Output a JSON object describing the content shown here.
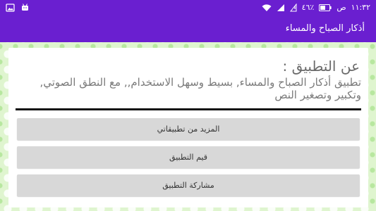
{
  "status_bar": {
    "time": "١١:٣٢",
    "ampm": "ص",
    "battery_percent": "٤٦٪",
    "icons": [
      "image-icon",
      "android-icon",
      "wifi-icon",
      "signal-icon",
      "no-sim-icon",
      "battery-icon"
    ]
  },
  "app_bar": {
    "title": "أذكار الصباح والمساء"
  },
  "about": {
    "heading": "عن التطبيق :",
    "body": "تطبيق أذكار الصباح والمساء, بسيط وسهل الاستخدام,, مع النطق الصوتي, وتكبير وتصغير النص"
  },
  "buttons": {
    "more_apps": "المزيد من تطبيقاتي",
    "rate_app": "قيم التطبيق",
    "share_app": "مشاركة التطبيق"
  },
  "colors": {
    "primary": "#6a1fd0",
    "background": "#dff5cf",
    "button": "#d8d8d8",
    "card": "#ffffff"
  }
}
